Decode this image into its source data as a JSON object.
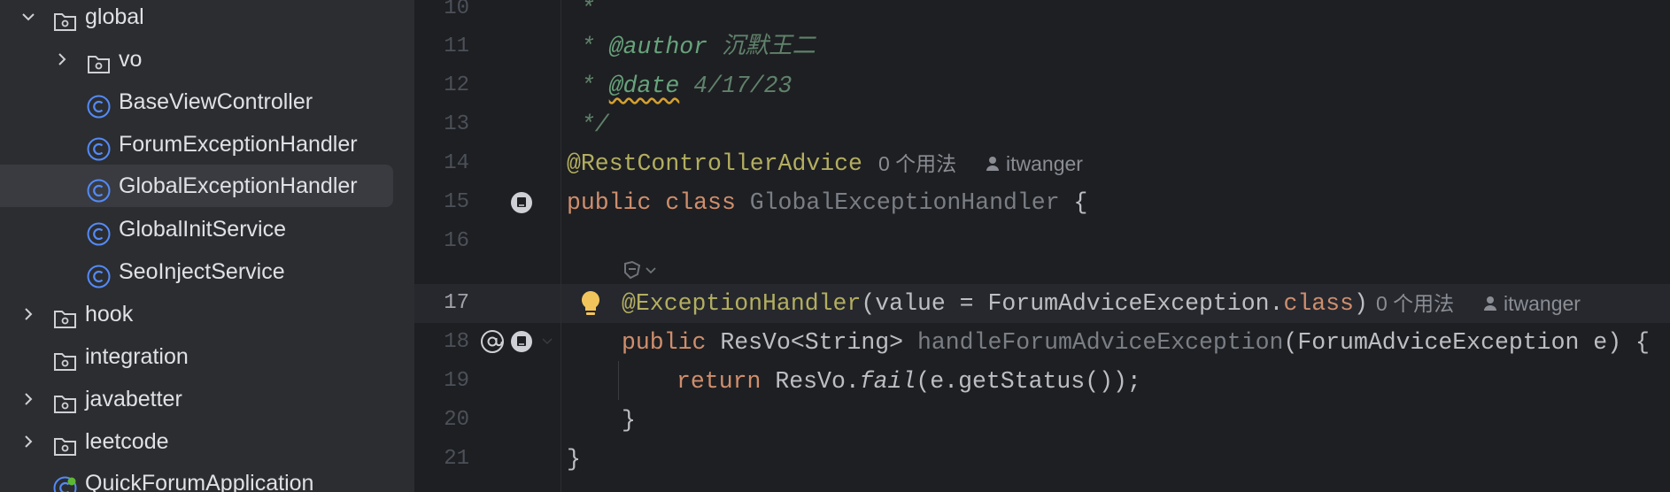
{
  "tree": {
    "items": [
      {
        "label": "global",
        "kind": "folder",
        "state": "expanded"
      },
      {
        "label": "vo",
        "kind": "folder",
        "state": "collapsed"
      },
      {
        "label": "BaseViewController",
        "kind": "class"
      },
      {
        "label": "ForumExceptionHandler",
        "kind": "class"
      },
      {
        "label": "GlobalExceptionHandler",
        "kind": "class",
        "selected": true
      },
      {
        "label": "GlobalInitService",
        "kind": "class"
      },
      {
        "label": "SeoInjectService",
        "kind": "class"
      },
      {
        "label": "hook",
        "kind": "folder",
        "state": "collapsed"
      },
      {
        "label": "integration",
        "kind": "folder"
      },
      {
        "label": "javabetter",
        "kind": "folder",
        "state": "collapsed"
      },
      {
        "label": "leetcode",
        "kind": "folder",
        "state": "collapsed"
      },
      {
        "label": "QuickForumApplication",
        "kind": "spring-class"
      }
    ]
  },
  "editor": {
    "line_numbers": [
      "10",
      "11",
      "12",
      "13",
      "14",
      "15",
      "16",
      "17",
      "18",
      "19",
      "20",
      "21"
    ],
    "current_line": "17",
    "doc_star": " *",
    "author_tag": "@author",
    "author_name": "沉默王二",
    "date_tag": "@date",
    "date_value": "4/17/23",
    "doc_end": " */",
    "rest_advice": "@RestControllerAdvice",
    "usages_1": "0 个用法",
    "author_hint_1": "itwanger",
    "kw_public": "public",
    "kw_class": "class",
    "class_name": "GlobalExceptionHandler",
    "brace_open": "{",
    "exc_ann": "@ExceptionHandler",
    "exc_args_a": "(value = ForumAdviceException.",
    "exc_args_class": "class",
    "exc_args_b": ")",
    "usages_2": "0 个用法",
    "author_hint_2": "itwanger",
    "ret_type": "ResVo<String>",
    "method_name": "handleForumAdviceException",
    "params": "(ForumAdviceException e) {",
    "kw_return": "return",
    "ret_expr_a": "ResVo.",
    "ret_expr_fail": "fail",
    "ret_expr_b": "(e.getStatus());",
    "inner_close": "}",
    "outer_close": "}"
  },
  "colors": {
    "tree_bg": "#2b2d30",
    "editor_bg": "#1e1f22",
    "selection": "#393b40",
    "class_icon": "#548af7",
    "folder_icon": "#ced0d6"
  }
}
